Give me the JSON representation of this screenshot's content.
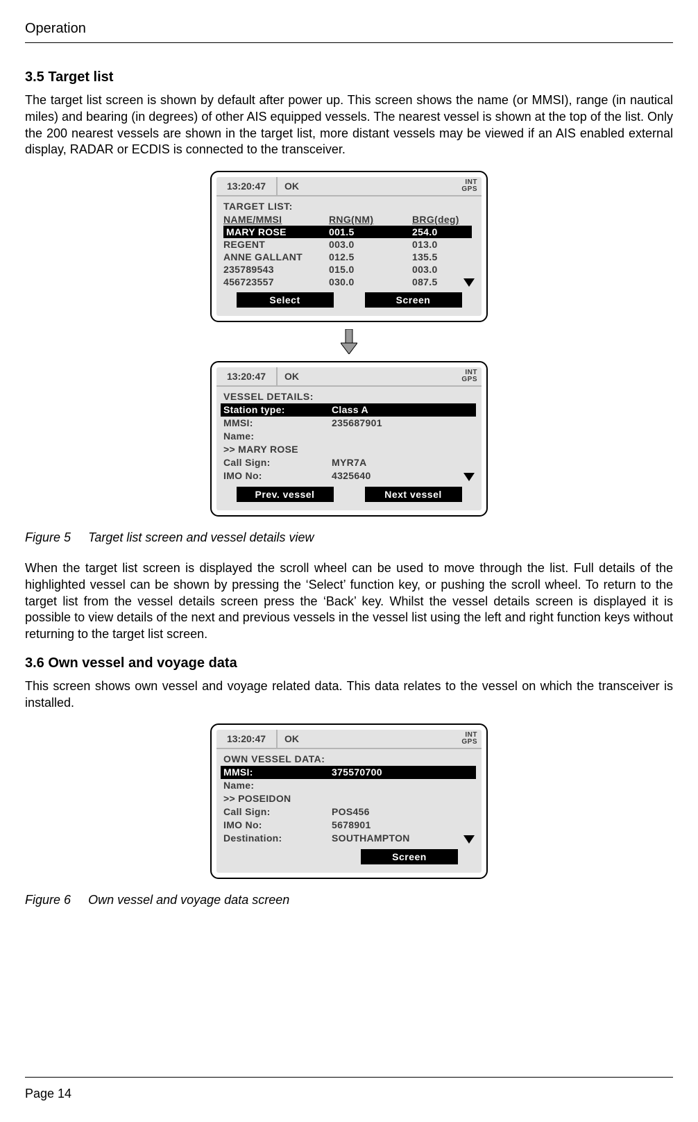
{
  "header": {
    "chapter": "Operation"
  },
  "section35": {
    "heading": "3.5    Target list",
    "para1": "The target list screen is shown by default after power up. This screen shows the name (or MMSI), range (in nautical miles) and bearing (in degrees) of other AIS equipped vessels. The nearest vessel is shown at the top of the list. Only the 200 nearest vessels are shown in the target list, more distant vessels may be viewed if an AIS enabled external display, RADAR or ECDIS is connected to the transceiver.",
    "figure_caption_label": "Figure 5",
    "figure_caption_text": "Target list screen and vessel details view",
    "para2": "When the target list screen is displayed the scroll wheel can be used to move through the list. Full details of the highlighted vessel can be shown by pressing the ‘Select’ function key, or pushing the scroll wheel. To return to the target list from the vessel details screen press the ‘Back’ key. Whilst the vessel details screen is displayed it is possible to view details of the next and previous vessels in the vessel list using the left and right function keys without returning to the target list screen."
  },
  "section36": {
    "heading": "3.6    Own vessel and voyage data",
    "para1": "This screen shows own vessel and voyage related data. This data relates to the vessel on which the transceiver is installed.",
    "figure_caption_label": "Figure 6",
    "figure_caption_text": "Own vessel and voyage data screen"
  },
  "device_common": {
    "time": "13:20:47",
    "status": "OK",
    "ind1": "INT",
    "ind2": "GPS"
  },
  "screen_target_list": {
    "title": "TARGET LIST:",
    "headers": {
      "c1": "NAME/MMSI",
      "c2": "RNG(NM)",
      "c3": "BRG(deg)"
    },
    "rows": [
      {
        "name": "MARY ROSE",
        "rng": "001.5",
        "brg": "254.0",
        "selected": true
      },
      {
        "name": "REGENT",
        "rng": "003.0",
        "brg": "013.0",
        "selected": false
      },
      {
        "name": "ANNE GALLANT",
        "rng": "012.5",
        "brg": "135.5",
        "selected": false
      },
      {
        "name": "235789543",
        "rng": "015.0",
        "brg": "003.0",
        "selected": false
      },
      {
        "name": "456723557",
        "rng": "030.0",
        "brg": "087.5",
        "selected": false
      }
    ],
    "softkeys": {
      "left": "Select",
      "right": "Screen"
    }
  },
  "screen_vessel_details": {
    "title": "VESSEL DETAILS:",
    "rows": [
      {
        "k": "Station type:",
        "v": "Class A",
        "selected": true
      },
      {
        "k": "MMSI:",
        "v": "235687901"
      },
      {
        "k": "Name:",
        "v": ""
      },
      {
        "k": ">> MARY ROSE",
        "v": ""
      },
      {
        "k": "Call Sign:",
        "v": "MYR7A"
      },
      {
        "k": "IMO No:",
        "v": "4325640"
      }
    ],
    "softkeys": {
      "left": "Prev. vessel",
      "right": "Next vessel"
    }
  },
  "screen_own_vessel": {
    "title": "OWN VESSEL DATA:",
    "rows": [
      {
        "k": "MMSI:",
        "v": "375570700",
        "selected": true
      },
      {
        "k": "Name:",
        "v": ""
      },
      {
        "k": ">> POSEIDON",
        "v": ""
      },
      {
        "k": "Call Sign:",
        "v": "POS456"
      },
      {
        "k": "IMO No:",
        "v": "5678901"
      },
      {
        "k": "Destination:",
        "v": "SOUTHAMPTON"
      }
    ],
    "softkeys": {
      "right": "Screen"
    }
  },
  "footer": {
    "page": "Page 14"
  }
}
